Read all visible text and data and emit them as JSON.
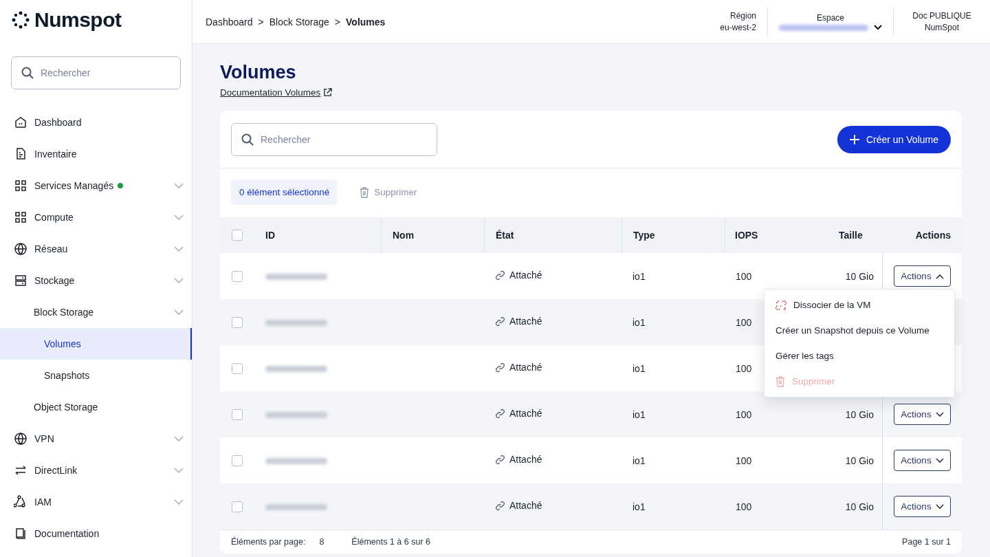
{
  "brand": {
    "name": "Numspot"
  },
  "sidebar": {
    "search": {
      "placeholder": "Rechercher"
    },
    "items": [
      {
        "label": "Dashboard",
        "selected": false
      },
      {
        "label": "Inventaire",
        "selected": false
      },
      {
        "label": "Services Managés",
        "selected": false,
        "expandable": true,
        "color": "#1f9d3a"
      },
      {
        "label": "Compute",
        "selected": false,
        "expandable": true
      },
      {
        "label": "Réseau",
        "selected": false,
        "expandable": true
      },
      {
        "label": "Stockage",
        "selected": false,
        "expandable": true,
        "children": [
          {
            "label": "Block Storage",
            "selected": false,
            "expandable": true,
            "children": [
              {
                "label": "Volumes",
                "selected": true
              },
              {
                "label": "Snapshots",
                "selected": false
              }
            ]
          },
          {
            "label": "Object Storage",
            "selected": false,
            "expandable": false
          }
        ]
      },
      {
        "label": "VPN",
        "selected": false,
        "expandable": true
      },
      {
        "label": "DirectLink",
        "selected": false,
        "expandable": true
      },
      {
        "label": "IAM",
        "selected": false,
        "expandable": true
      },
      {
        "label": "Documentation",
        "selected": false
      }
    ]
  },
  "breadcrumb": [
    {
      "label": "Dashboard",
      "separator": ">"
    },
    {
      "label": "Block Storage",
      "separator": ">"
    },
    {
      "label": "Volumes"
    }
  ],
  "header": {
    "region_label": "Région",
    "region": "eu-west-2",
    "space_label": "Espace",
    "doc_label": "Doc PUBLIQUE",
    "doc_value": "NumSpot"
  },
  "page": {
    "title": "Volumes",
    "doc_link": "Documentation Volumes"
  },
  "toolbar": {
    "search": {
      "placeholder": "Rechercher"
    },
    "create_button": "Créer un Volume"
  },
  "selection": {
    "count": "0 élément sélectionné",
    "delete": "Supprimer",
    "delete_disabled": true
  },
  "table": {
    "columns": [
      "ID",
      "Nom",
      "État",
      "Type",
      "IOPS",
      "Taille",
      "Actions"
    ],
    "select_all": false,
    "rows": [
      {
        "checked": false,
        "state": "Attaché",
        "type": "io1",
        "iops": "100",
        "size": "10 Gio",
        "actions": "Actions",
        "expanded": true
      },
      {
        "checked": false,
        "state": "Attaché",
        "type": "io1",
        "iops": "100"
      },
      {
        "checked": false,
        "state": "Attaché",
        "type": "io1",
        "iops": "100"
      },
      {
        "checked": false,
        "state": "Attaché",
        "type": "io1",
        "iops": "100",
        "size": "10 Gio",
        "actions": "Actions",
        "expanded": false
      },
      {
        "checked": false,
        "state": "Attaché",
        "type": "io1",
        "iops": "100",
        "size": "10 Gio",
        "actions": "Actions",
        "expanded": false
      },
      {
        "checked": false,
        "state": "Attaché",
        "type": "io1",
        "iops": "100",
        "size": "10 Gio",
        "actions": "Actions",
        "expanded": false
      }
    ]
  },
  "menu": [
    {
      "label": "Dissocier de la VM",
      "kind": "unlink",
      "disabled": false
    },
    {
      "label": "Créer un Snapshot depuis ce Volume",
      "kind": "plain",
      "disabled": false
    },
    {
      "label": "Gérer les tags",
      "kind": "plain",
      "disabled": false
    },
    {
      "label": "Supprimer",
      "kind": "delete",
      "disabled": true
    }
  ],
  "footer": {
    "per_page_label": "Éléments par page:",
    "per_page": "8",
    "range": "Éléments 1 à 6 sur 6",
    "page": "Page 1 sur 1"
  }
}
